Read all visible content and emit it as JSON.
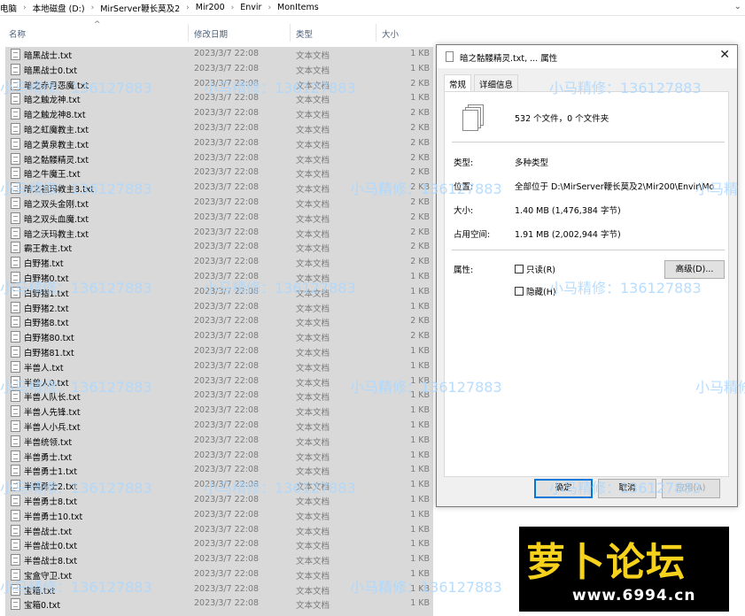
{
  "breadcrumb": [
    "电脑",
    "本地磁盘 (D:)",
    "MirServer鞭长莫及2",
    "Mir200",
    "Envir",
    "MonItems"
  ],
  "columns": {
    "name": "名称",
    "date": "修改日期",
    "type": "类型",
    "size": "大小"
  },
  "files": [
    {
      "name": "暗黑战士.txt",
      "date": "2023/3/7 22:08",
      "type": "文本文档",
      "size": "1 KB"
    },
    {
      "name": "暗黑战士0.txt",
      "date": "2023/3/7 22:08",
      "type": "文本文档",
      "size": "1 KB"
    },
    {
      "name": "暗之赤月恶魔.txt",
      "date": "2023/3/7 22:08",
      "type": "文本文档",
      "size": "2 KB"
    },
    {
      "name": "暗之触龙神.txt",
      "date": "2023/3/7 22:08",
      "type": "文本文档",
      "size": "1 KB"
    },
    {
      "name": "暗之触龙神8.txt",
      "date": "2023/3/7 22:08",
      "type": "文本文档",
      "size": "2 KB"
    },
    {
      "name": "暗之虹魔教主.txt",
      "date": "2023/3/7 22:08",
      "type": "文本文档",
      "size": "2 KB"
    },
    {
      "name": "暗之黄泉教主.txt",
      "date": "2023/3/7 22:08",
      "type": "文本文档",
      "size": "2 KB"
    },
    {
      "name": "暗之骷髅精灵.txt",
      "date": "2023/3/7 22:08",
      "type": "文本文档",
      "size": "2 KB"
    },
    {
      "name": "暗之牛魔王.txt",
      "date": "2023/3/7 22:08",
      "type": "文本文档",
      "size": "2 KB"
    },
    {
      "name": "暗之祖玛教主8.txt",
      "date": "2023/3/7 22:08",
      "type": "文本文档",
      "size": "2 KB"
    },
    {
      "name": "暗之双头金刚.txt",
      "date": "2023/3/7 22:08",
      "type": "文本文档",
      "size": "2 KB"
    },
    {
      "name": "暗之双头血魔.txt",
      "date": "2023/3/7 22:08",
      "type": "文本文档",
      "size": "2 KB"
    },
    {
      "name": "暗之沃玛教主.txt",
      "date": "2023/3/7 22:08",
      "type": "文本文档",
      "size": "2 KB"
    },
    {
      "name": "霸王教主.txt",
      "date": "2023/3/7 22:08",
      "type": "文本文档",
      "size": "2 KB"
    },
    {
      "name": "白野猪.txt",
      "date": "2023/3/7 22:08",
      "type": "文本文档",
      "size": "2 KB"
    },
    {
      "name": "白野猪0.txt",
      "date": "2023/3/7 22:08",
      "type": "文本文档",
      "size": "1 KB"
    },
    {
      "name": "白野猪1.txt",
      "date": "2023/3/7 22:08",
      "type": "文本文档",
      "size": "1 KB"
    },
    {
      "name": "白野猪2.txt",
      "date": "2023/3/7 22:08",
      "type": "文本文档",
      "size": "1 KB"
    },
    {
      "name": "白野猪8.txt",
      "date": "2023/3/7 22:08",
      "type": "文本文档",
      "size": "2 KB"
    },
    {
      "name": "白野猪80.txt",
      "date": "2023/3/7 22:08",
      "type": "文本文档",
      "size": "2 KB"
    },
    {
      "name": "白野猪81.txt",
      "date": "2023/3/7 22:08",
      "type": "文本文档",
      "size": "1 KB"
    },
    {
      "name": "半兽人.txt",
      "date": "2023/3/7 22:08",
      "type": "文本文档",
      "size": "1 KB"
    },
    {
      "name": "半兽人0.txt",
      "date": "2023/3/7 22:08",
      "type": "文本文档",
      "size": "1 KB"
    },
    {
      "name": "半兽人队长.txt",
      "date": "2023/3/7 22:08",
      "type": "文本文档",
      "size": "1 KB"
    },
    {
      "name": "半兽人先锋.txt",
      "date": "2023/3/7 22:08",
      "type": "文本文档",
      "size": "1 KB"
    },
    {
      "name": "半兽人小兵.txt",
      "date": "2023/3/7 22:08",
      "type": "文本文档",
      "size": "1 KB"
    },
    {
      "name": "半兽统领.txt",
      "date": "2023/3/7 22:08",
      "type": "文本文档",
      "size": "1 KB"
    },
    {
      "name": "半兽勇士.txt",
      "date": "2023/3/7 22:08",
      "type": "文本文档",
      "size": "1 KB"
    },
    {
      "name": "半兽勇士1.txt",
      "date": "2023/3/7 22:08",
      "type": "文本文档",
      "size": "1 KB"
    },
    {
      "name": "半兽勇士2.txt",
      "date": "2023/3/7 22:08",
      "type": "文本文档",
      "size": "1 KB"
    },
    {
      "name": "半兽勇士8.txt",
      "date": "2023/3/7 22:08",
      "type": "文本文档",
      "size": "1 KB"
    },
    {
      "name": "半兽勇士10.txt",
      "date": "2023/3/7 22:08",
      "type": "文本文档",
      "size": "1 KB"
    },
    {
      "name": "半兽战士.txt",
      "date": "2023/3/7 22:08",
      "type": "文本文档",
      "size": "1 KB"
    },
    {
      "name": "半兽战士0.txt",
      "date": "2023/3/7 22:08",
      "type": "文本文档",
      "size": "1 KB"
    },
    {
      "name": "半兽战士8.txt",
      "date": "2023/3/7 22:08",
      "type": "文本文档",
      "size": "1 KB"
    },
    {
      "name": "宝盒守卫.txt",
      "date": "2023/3/7 22:08",
      "type": "文本文档",
      "size": "1 KB"
    },
    {
      "name": "宝箱.txt",
      "date": "2023/3/7 22:08",
      "type": "文本文档",
      "size": "1 KB"
    },
    {
      "name": "宝箱0.txt",
      "date": "2023/3/7 22:08",
      "type": "文本文档",
      "size": "1 KB"
    }
  ],
  "dialog": {
    "title": "暗之骷髅精灵.txt, ... 属性",
    "tabs": [
      "常规",
      "详细信息"
    ],
    "summary": "532 个文件，0 个文件夹",
    "type_label": "类型:",
    "type_value": "多种类型",
    "location_label": "位置:",
    "location_value": "全部位于 D:\\MirServer鞭长莫及2\\Mir200\\Envir\\Mo",
    "size_label": "大小:",
    "size_value": "1.40 MB (1,476,384 字节)",
    "disk_label": "占用空间:",
    "disk_value": "1.91 MB (2,002,944 字节)",
    "attr_label": "属性:",
    "readonly_label": "只读(R)",
    "hidden_label": "隐藏(H)",
    "advanced_label": "高级(D)...",
    "ok_label": "确定",
    "cancel_label": "取消",
    "apply_label": "应用(A)"
  },
  "watermark": {
    "text_a": "小马精修：136127883",
    "text_b": "小马精修",
    "text_c": "136127883",
    "text_d": "小马精"
  },
  "logo": {
    "main": "萝卜论坛",
    "url": "www.6994.cn"
  }
}
